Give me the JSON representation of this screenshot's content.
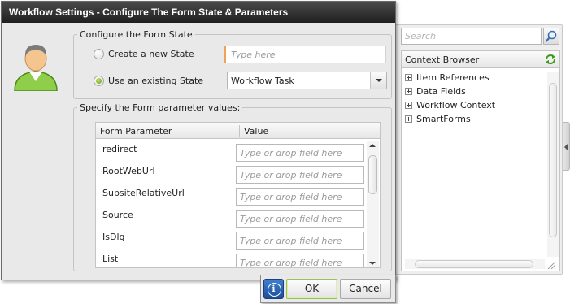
{
  "dialog": {
    "title": "Workflow Settings - Configure The Form State & Parameters",
    "form_state_group": {
      "legend": "Configure the Form State",
      "create_new_label": "Create a new State",
      "create_new_placeholder": "Type here",
      "use_existing_label": "Use an existing State",
      "existing_state_value": "Workflow Task",
      "selected_option": "Use an existing State"
    },
    "params_group": {
      "legend": "Specify the Form parameter values:",
      "columns": [
        "Form Parameter",
        "Value"
      ],
      "value_placeholder": "Type or drop field here",
      "rows": [
        {
          "name": "redirect"
        },
        {
          "name": "RootWebUrl"
        },
        {
          "name": "SubsiteRelativeUrl"
        },
        {
          "name": "Source"
        },
        {
          "name": "IsDlg"
        },
        {
          "name": "List"
        }
      ]
    },
    "buttons": {
      "info": "i",
      "ok": "OK",
      "cancel": "Cancel"
    }
  },
  "context_browser": {
    "search_placeholder": "Search",
    "title": "Context Browser",
    "items": [
      "Item References",
      "Data Fields",
      "Workflow Context",
      "SmartForms"
    ]
  },
  "colors": {
    "titlebar": "#2f2f2f",
    "accent_green": "#5f9a14",
    "info_blue": "#1b4f9b",
    "focus_orange": "#f0a25a"
  }
}
